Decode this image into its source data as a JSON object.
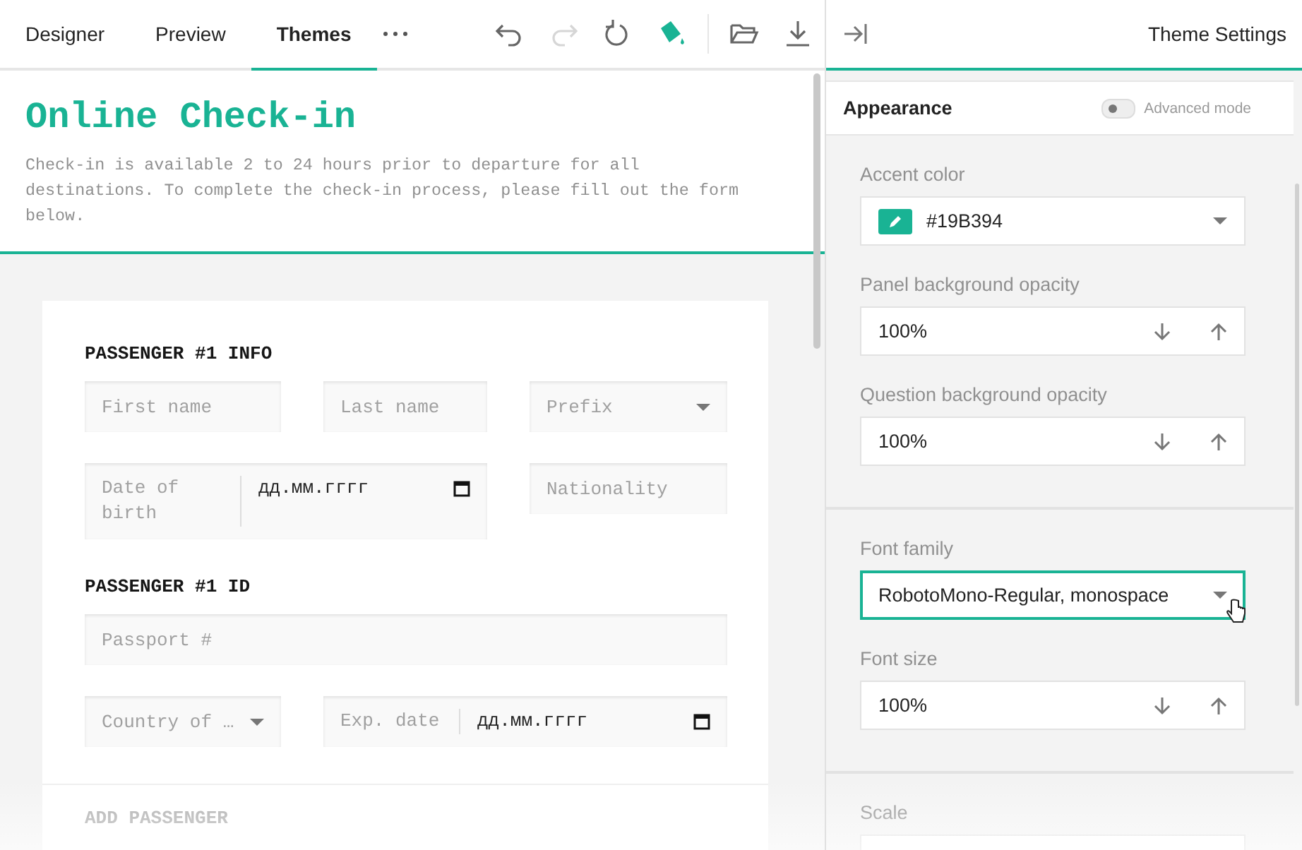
{
  "tabs": [
    {
      "label": "Designer",
      "selected": false
    },
    {
      "label": "Preview",
      "selected": false
    },
    {
      "label": "Themes",
      "selected": true
    }
  ],
  "toolbar": [
    {
      "kind": "undo",
      "disabled": false,
      "selected": false
    },
    {
      "kind": "redo",
      "disabled": true,
      "selected": false
    },
    {
      "kind": "reset",
      "disabled": false,
      "selected": false
    },
    {
      "kind": "theme",
      "disabled": false,
      "selected": true
    },
    {
      "kind": "open",
      "disabled": false,
      "selected": false
    },
    {
      "kind": "download",
      "disabled": false,
      "selected": false
    }
  ],
  "survey": {
    "title": "Online Check-in",
    "description": "Check-in is available 2 to 24 hours prior to departure for all destinations. To complete the check-in process, please fill out the form below.",
    "panels": [
      {
        "title": "PASSENGER #1 INFO",
        "fields": [
          {
            "kind": "text",
            "placeholder": "First name",
            "full_width": false
          },
          {
            "kind": "text",
            "placeholder": "Last name",
            "full_width": false
          },
          {
            "kind": "dropdown",
            "placeholder": "Prefix",
            "full_width": false
          },
          {
            "kind": "date",
            "label": "Date of birth",
            "value": "дд.мм.гггг",
            "full_width": false
          },
          {
            "kind": "text",
            "placeholder": "Nationality",
            "full_width": false
          }
        ]
      },
      {
        "title": "PASSENGER #1 ID",
        "fields": [
          {
            "kind": "text",
            "placeholder": "Passport #",
            "full_width": true
          },
          {
            "kind": "dropdown",
            "placeholder": "Country of …",
            "full_width": false
          },
          {
            "kind": "date",
            "label": "Exp. date",
            "value": "дд.мм.гггг",
            "full_width": false
          }
        ]
      }
    ],
    "add_button": "ADD PASSENGER"
  },
  "settings": {
    "title": "Theme Settings",
    "section": "Appearance",
    "advanced_mode": {
      "label": "Advanced mode",
      "on": false
    },
    "groups": [
      [
        {
          "label": "Accent color",
          "kind": "color",
          "value": "#19B394",
          "color": "#19b394",
          "focused": false
        },
        {
          "label": "Panel background opacity",
          "kind": "spinner",
          "value": "100%",
          "focused": false
        },
        {
          "label": "Question background opacity",
          "kind": "spinner",
          "value": "100%",
          "focused": false
        }
      ],
      [
        {
          "label": "Font family",
          "kind": "dropdown",
          "value": "RobotoMono-Regular, monospace",
          "focused": true
        },
        {
          "label": "Font size",
          "kind": "spinner",
          "value": "100%",
          "focused": false
        }
      ],
      [
        {
          "label": "Scale",
          "kind": "empty",
          "focused": false
        }
      ]
    ]
  }
}
